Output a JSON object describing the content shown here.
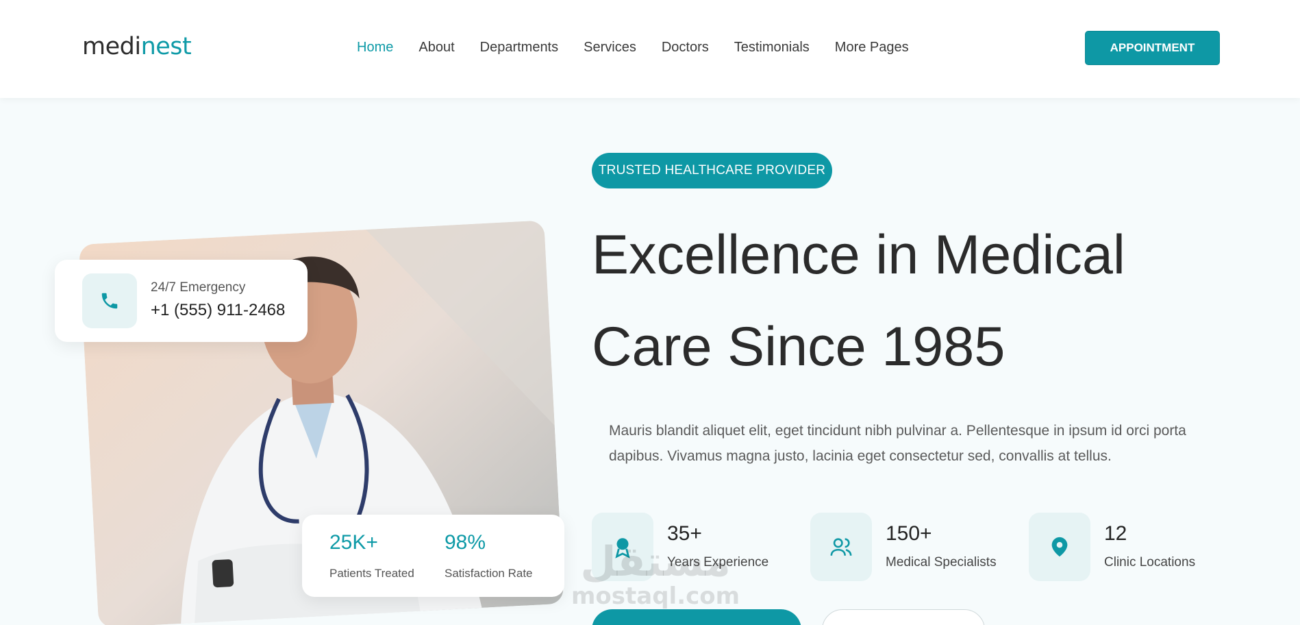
{
  "header": {
    "logo_part1": "medi",
    "logo_part2": "nest",
    "nav": [
      {
        "label": "Home"
      },
      {
        "label": "About"
      },
      {
        "label": "Departments"
      },
      {
        "label": "Services"
      },
      {
        "label": "Doctors"
      },
      {
        "label": "Testimonials"
      },
      {
        "label": "More Pages"
      }
    ],
    "cta_label": "APPOINTMENT"
  },
  "emergency": {
    "label": "24/7 Emergency",
    "phone": "+1 (555) 911-2468"
  },
  "photo_stats": [
    {
      "value": "25K+",
      "label": "Patients Treated"
    },
    {
      "value": "98%",
      "label": "Satisfaction Rate"
    }
  ],
  "hero": {
    "badge": "TRUSTED HEALTHCARE PROVIDER",
    "title_line1": "Excellence in Medical",
    "title_line2": "Care Since 1985",
    "description": "Mauris blandit aliquet elit, eget tincidunt nibh pulvinar a. Pellentesque in ipsum id orci porta dapibus. Vivamus magna justo, lacinia eget consectetur sed, convallis at tellus."
  },
  "stats": [
    {
      "icon": "award-icon",
      "value": "35+",
      "label": "Years Experience"
    },
    {
      "icon": "users-icon",
      "value": "150+",
      "label": "Medical Specialists"
    },
    {
      "icon": "location-pin-icon",
      "value": "12",
      "label": "Clinic Locations"
    }
  ],
  "watermark": {
    "arabic": "مستقل",
    "latin": "mostaql.com"
  },
  "colors": {
    "accent": "#0e98a5",
    "icon_bg": "#e6f3f4"
  }
}
